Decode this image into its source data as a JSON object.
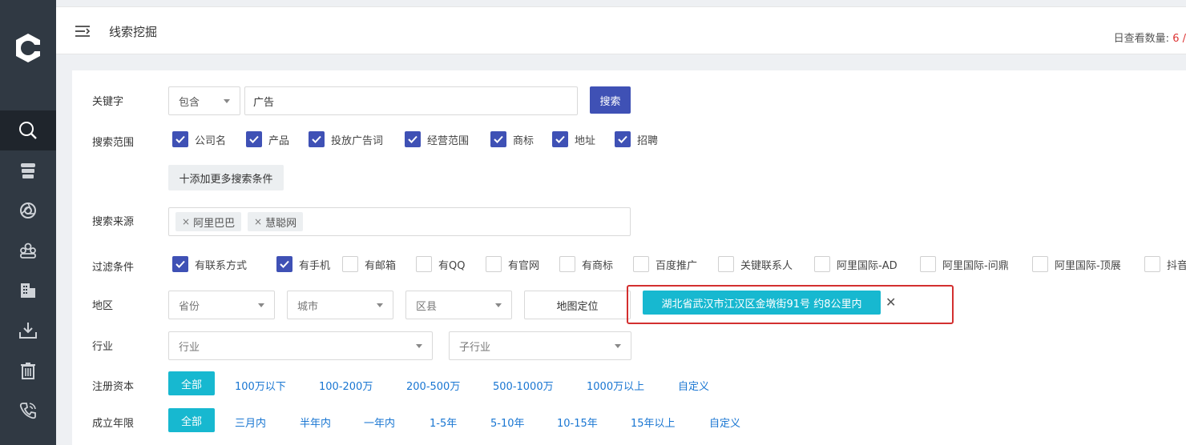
{
  "header": {
    "title": "线索挖掘",
    "daily_label": "日查看数量:",
    "daily_count": "6 /"
  },
  "sidebar": {
    "items": [
      {
        "icon": "search-icon",
        "active": true
      },
      {
        "icon": "database-icon"
      },
      {
        "icon": "aperture-icon"
      },
      {
        "icon": "group-icon"
      },
      {
        "icon": "building-icon"
      },
      {
        "icon": "download-icon"
      },
      {
        "icon": "trash-icon"
      },
      {
        "icon": "phone-icon"
      }
    ]
  },
  "keyword": {
    "label": "关键字",
    "mode": "包含",
    "value": "广告",
    "search_button": "搜索"
  },
  "scope": {
    "label": "搜索范围",
    "options": [
      {
        "label": "公司名",
        "checked": true
      },
      {
        "label": "产品",
        "checked": true
      },
      {
        "label": "投放广告词",
        "checked": true
      },
      {
        "label": "经营范围",
        "checked": true
      },
      {
        "label": "商标",
        "checked": true
      },
      {
        "label": "地址",
        "checked": true
      },
      {
        "label": "招聘",
        "checked": true
      }
    ],
    "add_more": "十添加更多搜索条件"
  },
  "source": {
    "label": "搜索来源",
    "tags": [
      "阿里巴巴",
      "慧聪网"
    ]
  },
  "filter": {
    "label": "过滤条件",
    "options": [
      {
        "label": "有联系方式",
        "checked": true
      },
      {
        "label": "有手机",
        "checked": true
      },
      {
        "label": "有邮箱",
        "checked": false
      },
      {
        "label": "有QQ",
        "checked": false
      },
      {
        "label": "有官网",
        "checked": false
      },
      {
        "label": "有商标",
        "checked": false
      },
      {
        "label": "百度推广",
        "checked": false
      },
      {
        "label": "关键联系人",
        "checked": false
      },
      {
        "label": "阿里国际-AD",
        "checked": false
      },
      {
        "label": "阿里国际-问鼎",
        "checked": false
      },
      {
        "label": "阿里国际-顶展",
        "checked": false
      },
      {
        "label": "抖音",
        "checked": false
      }
    ]
  },
  "region": {
    "label": "地区",
    "province_placeholder": "省份",
    "city_placeholder": "城市",
    "district_placeholder": "区县",
    "map_button": "地图定位",
    "location_chip": "湖北省武汉市江汉区金墩街91号 约8公里内",
    "close": "✕"
  },
  "industry": {
    "label": "行业",
    "industry_placeholder": "行业",
    "sub_placeholder": "子行业"
  },
  "capital": {
    "label": "注册资本",
    "options": [
      "全部",
      "100万以下",
      "100-200万",
      "200-500万",
      "500-1000万",
      "1000万以上",
      "自定义"
    ],
    "active": "全部"
  },
  "age": {
    "label": "成立年限",
    "options": [
      "全部",
      "三月内",
      "半年内",
      "一年内",
      "1-5年",
      "5-10年",
      "10-15年",
      "15年以上",
      "自定义"
    ],
    "active": "全部"
  },
  "colors": {
    "sidebar_bg": "#303943",
    "primary": "#3f51b5",
    "accent": "#17b8d0",
    "link": "#1976d2",
    "highlight_border": "#d32f2f"
  }
}
